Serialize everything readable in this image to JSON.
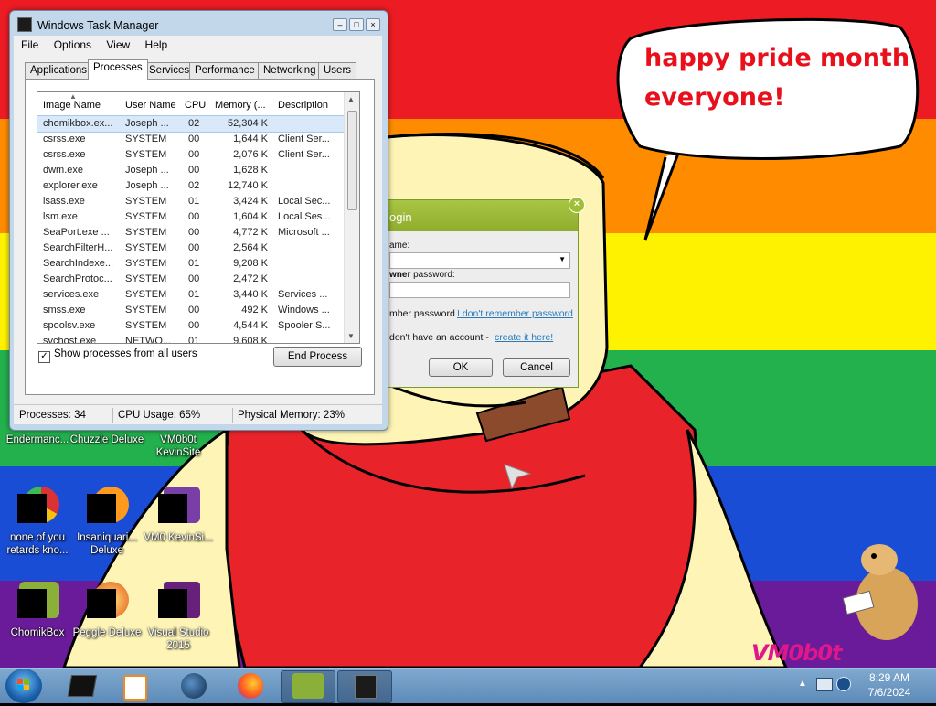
{
  "wallpaper": {
    "speech_lines": [
      "happy pride month",
      "everyone!"
    ],
    "signature": "VM0b0t"
  },
  "desktop_icons": [
    {
      "label": "Endermanc...",
      "icon": "program-icon"
    },
    {
      "label": "Chuzzle Deluxe",
      "icon": "chuzzle-icon"
    },
    {
      "label": "VM0b0t KevinSite",
      "icon": "folder-icon"
    },
    {
      "label": "none of you retards kno...",
      "icon": "chrome-icon"
    },
    {
      "label": "Insaniquari... Deluxe",
      "icon": "insaniquarium-icon"
    },
    {
      "label": "VM0 KevinSi...",
      "icon": "folder-icon"
    },
    {
      "label": "ChomikBox",
      "icon": "chomikbox-icon"
    },
    {
      "label": "Peggle Deluxe",
      "icon": "peggle-icon"
    },
    {
      "label": "Visual Studio 2015",
      "icon": "visual-studio-icon"
    }
  ],
  "task_manager": {
    "title": "Windows Task Manager",
    "menu": [
      "File",
      "Options",
      "View",
      "Help"
    ],
    "tabs": [
      "Applications",
      "Processes",
      "Services",
      "Performance",
      "Networking",
      "Users"
    ],
    "active_tab": "Processes",
    "columns": [
      "Image Name",
      "User Name",
      "CPU",
      "Memory (...",
      "Description"
    ],
    "rows": [
      [
        "chomikbox.ex...",
        "Joseph ...",
        "02",
        "52,304 K",
        ""
      ],
      [
        "csrss.exe",
        "SYSTEM",
        "00",
        "1,644 K",
        "Client Ser..."
      ],
      [
        "csrss.exe",
        "SYSTEM",
        "00",
        "2,076 K",
        "Client Ser..."
      ],
      [
        "dwm.exe",
        "Joseph ...",
        "00",
        "1,628 K",
        ""
      ],
      [
        "explorer.exe",
        "Joseph ...",
        "02",
        "12,740 K",
        ""
      ],
      [
        "lsass.exe",
        "SYSTEM",
        "01",
        "3,424 K",
        "Local Sec..."
      ],
      [
        "lsm.exe",
        "SYSTEM",
        "00",
        "1,604 K",
        "Local Ses..."
      ],
      [
        "SeaPort.exe ...",
        "SYSTEM",
        "00",
        "4,772 K",
        "Microsoft ..."
      ],
      [
        "SearchFilterH...",
        "SYSTEM",
        "00",
        "2,564 K",
        ""
      ],
      [
        "SearchIndexe...",
        "SYSTEM",
        "01",
        "9,208 K",
        ""
      ],
      [
        "SearchProtoc...",
        "SYSTEM",
        "00",
        "2,472 K",
        ""
      ],
      [
        "services.exe",
        "SYSTEM",
        "01",
        "3,440 K",
        "Services ..."
      ],
      [
        "smss.exe",
        "SYSTEM",
        "00",
        "492 K",
        "Windows ..."
      ],
      [
        "spoolsv.exe",
        "SYSTEM",
        "00",
        "4,544 K",
        "Spooler S..."
      ],
      [
        "svchost.exe",
        "NETWO...",
        "01",
        "9,608 K",
        ""
      ]
    ],
    "show_all_label": "Show processes from all users",
    "show_all_checked": true,
    "end_process_label": "End Process",
    "status": {
      "processes": "Processes: 34",
      "cpu": "CPU Usage: 65%",
      "memory": "Physical Memory: 23%"
    }
  },
  "login": {
    "title": "ogin",
    "close_glyph": "×",
    "username_label": "ame:",
    "password_label_bold": "wner",
    "password_label": "password:",
    "remember_label": "mber password",
    "forgot_link": "I don't remember password",
    "no_account_text": "don't have an account -",
    "create_link": "create it here!",
    "ok_label": "OK",
    "cancel_label": "Cancel"
  },
  "taskbar": {
    "time": "8:29 AM",
    "date": "7/6/2024",
    "pinned": [
      "cmd-icon",
      "media-player-icon",
      "steam-icon",
      "firefox-icon",
      "chomikbox-icon",
      "task-manager-icon"
    ]
  }
}
